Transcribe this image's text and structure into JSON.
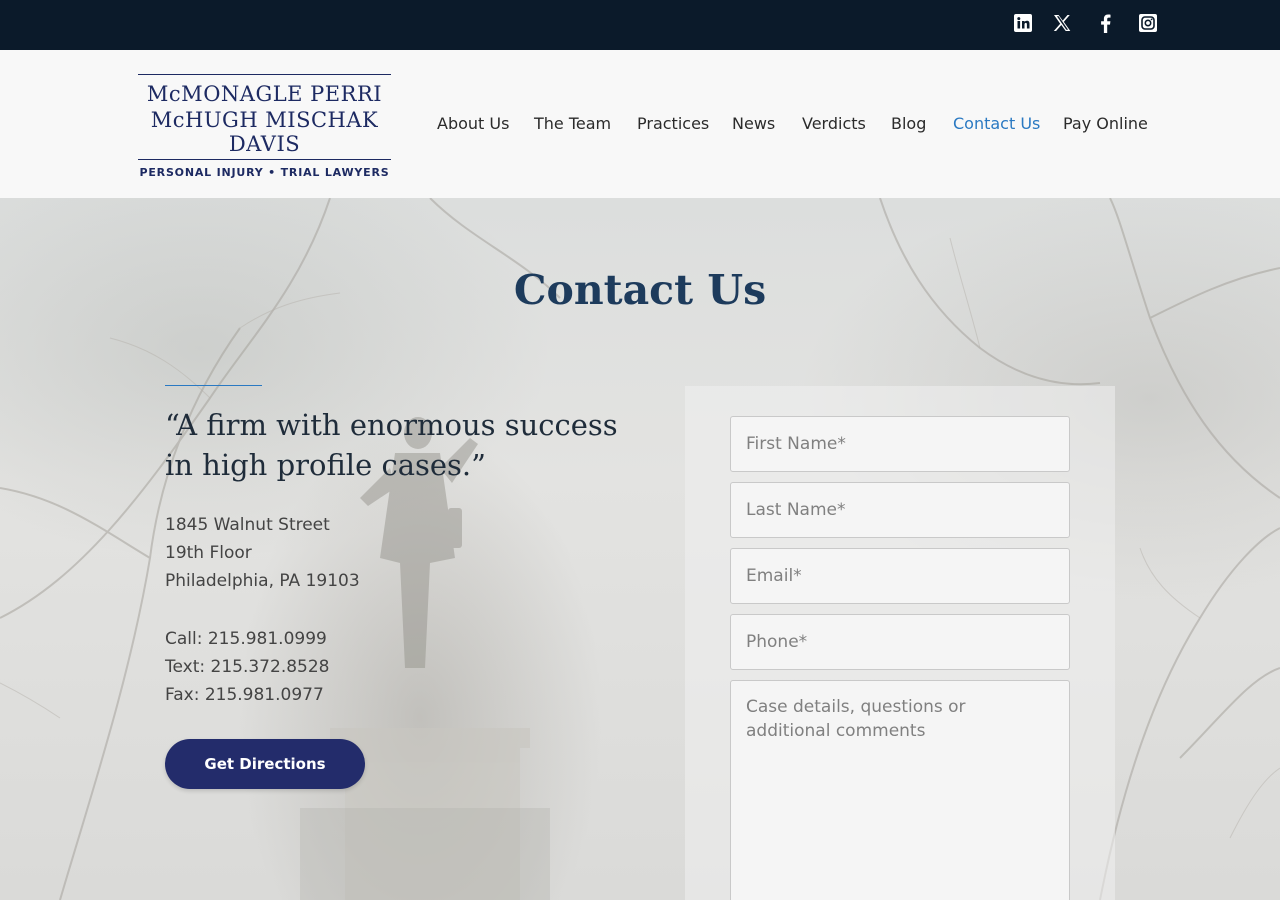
{
  "social": [
    {
      "icon": "linkedin-icon",
      "name": "LinkedIn"
    },
    {
      "icon": "x-twitter-icon",
      "name": "X"
    },
    {
      "icon": "facebook-icon",
      "name": "Facebook"
    },
    {
      "icon": "instagram-icon",
      "name": "Instagram"
    }
  ],
  "logo": {
    "line1": "McMONAGLE PERRI",
    "line2": "McHUGH MISCHAK",
    "line3": "DAVIS",
    "tagline": "PERSONAL INJURY • TRIAL LAWYERS"
  },
  "nav": {
    "items": [
      "About Us",
      "The Team",
      "Practices",
      "News",
      "Verdicts",
      "Blog",
      "Contact Us",
      "Pay Online"
    ],
    "active": "Contact Us"
  },
  "hero": {
    "title": "Contact Us",
    "quote": "“A firm with enormous success in high profile cases.”",
    "address": [
      "1845 Walnut Street",
      "19th Floor",
      "Philadelphia, PA 19103"
    ],
    "phones": [
      "Call: 215.981.0999",
      "Text: 215.372.8528",
      "Fax: 215.981.0977"
    ],
    "directions_label": "Get Directions"
  },
  "form": {
    "first_name_placeholder": "First Name*",
    "last_name_placeholder": "Last Name*",
    "email_placeholder": "Email*",
    "phone_placeholder": "Phone*",
    "comments_placeholder": "Case details, questions or additional comments"
  },
  "colors": {
    "topbar": "#0b1a2a",
    "brand_navy": "#1d2a62",
    "button": "#232c6b",
    "active_link": "#2a79c2"
  }
}
